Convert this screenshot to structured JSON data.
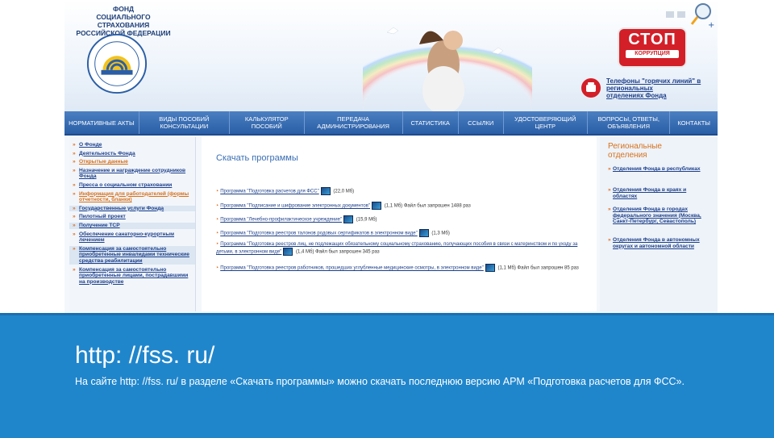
{
  "header": {
    "logo_lines": [
      "ФОНД",
      "СОЦИАЛЬНОГО СТРАХОВАНИЯ",
      "РОССИЙСКОЙ ФЕДЕРАЦИИ"
    ],
    "stop_big": "СТОП",
    "stop_small": "КОРРУПЦИЯ",
    "hotline_lines": [
      "Телефоны \"горячих линий\" в",
      "региональных",
      "отделениях Фонда"
    ]
  },
  "nav": [
    "НОРМАТИВНЫЕ АКТЫ",
    "ВИДЫ ПОСОБИЙ КОНСУЛЬТАЦИИ",
    "КАЛЬКУЛЯТОР ПОСОБИЙ",
    "ПЕРЕДАЧА АДМИНИСТРИРОВАНИЯ",
    "СТАТИСТИКА",
    "ССЫЛКИ",
    "УДОСТОВЕРЯЮЩИЙ ЦЕНТР",
    "ВОПРОСЫ, ОТВЕТЫ, ОБЪЯВЛЕНИЯ",
    "КОНТАКТЫ"
  ],
  "left_menu": [
    "О Фонде",
    "Деятельность Фонда",
    "Открытые данные",
    "Назначение и награждение сотрудников Фонда",
    "Пресса о социальном страховании",
    "Информация для работодателей (формы отчетности, бланки)",
    "Государственные услуги Фонда",
    "Пилотный проект",
    "Получение ТСР",
    "Обеспечение санаторно-курортным лечением",
    "Компенсация за самостоятельно приобретенные инвалидами технические средства реабилитации",
    "Компенсация за самостоятельно приобретенные лицами, пострадавшими на производстве"
  ],
  "main": {
    "title": "Скачать программы",
    "downloads": [
      {
        "link": "Программа \"Подготовка расчетов для ФСС\"",
        "info": "(22,0 Мб)"
      },
      {
        "link": "Программа \"Подписание и шифрование электронных документов\"",
        "info": "(1,1 Мб) Файл был запрошен 1488 раз"
      },
      {
        "link": "Программа \"Лечебно-профилактическое учреждение\"",
        "info": "(15,9 Мб)"
      },
      {
        "link": "Программа \"Подготовка реестров талонов родовых сертификатов в электронном виде\"",
        "info": "(1,3 Мб)"
      },
      {
        "link": "Программа \"Подготовка реестров лиц, не подлежащих обязательному социальному страхованию, получающих пособия в связи с материнством и по уходу за детьми, в электронном виде\"",
        "info": "(1,4 Мб) Файл был запрошен 345 раз"
      },
      {
        "link": "Программа \"Подготовка реестров работников, прошедших углубленные медицинские осмотры, в электронном виде\"",
        "info": "(1,1 Мб) Файл был запрошен 85 раз"
      }
    ]
  },
  "right": {
    "title_lines": [
      "Региональные",
      "отделения"
    ],
    "items": [
      "Отделения Фонда в республиках",
      "Отделения Фонда в краях и областях",
      "Отделения Фонда в городах федерального значения (Москва, Санкт-Петербург, Севастополь)",
      "Отделения Фонда в автономных округах и автономной области"
    ]
  },
  "band": {
    "title": "http: //fss. ru/",
    "description": "На сайте http: //fss. ru/ в разделе «Скачать программы» можно скачать последнюю версию АРМ «Подготовка расчетов для ФСС»."
  },
  "colors": {
    "band": "#2086cc",
    "nav": "#2a5ea6",
    "stop": "#d31f28",
    "accent_orange": "#d7701b"
  }
}
